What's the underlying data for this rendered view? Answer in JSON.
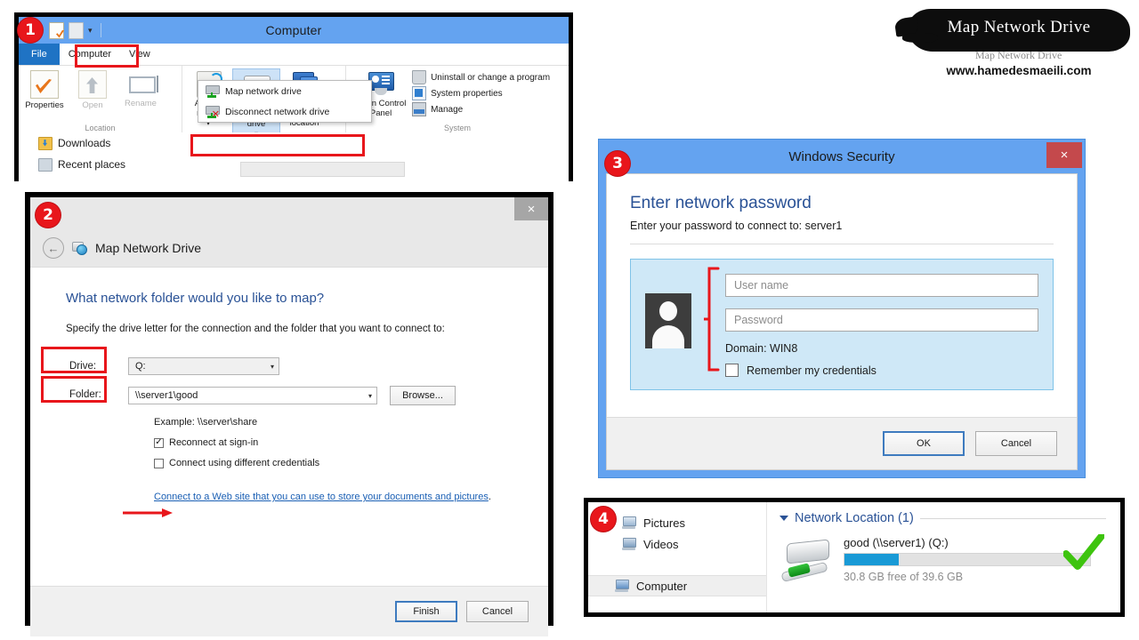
{
  "branding": {
    "title": "Map Network Drive",
    "ghost_text": "Map Network Drive",
    "url": "www.hamedesmaeili.com"
  },
  "panel1": {
    "step_badge": "1",
    "window_title": "Computer",
    "quick_access": [
      "properties-doc-icon",
      "folder-icon",
      "dropdown-arrow-icon"
    ],
    "tabs": [
      {
        "label": "File",
        "state": "file-menu"
      },
      {
        "label": "Computer",
        "state": "selected"
      },
      {
        "label": "View",
        "state": "normal"
      }
    ],
    "ribbon_groups": [
      {
        "group_label": "Location",
        "buttons": [
          {
            "label": "Properties",
            "icon": "properties-icon",
            "enabled": true
          },
          {
            "label": "Open",
            "icon": "open-icon",
            "enabled": false
          },
          {
            "label": "Rename",
            "icon": "rename-icon",
            "enabled": false
          }
        ]
      },
      {
        "group_label": "",
        "buttons": [
          {
            "label": "Access media",
            "icon": "access-media-icon",
            "enabled": true,
            "has_dropdown": true
          },
          {
            "label": "Map network drive",
            "icon": "map-network-drive-icon",
            "enabled": true,
            "has_dropdown": true,
            "active": true
          },
          {
            "label": "Add a network location",
            "icon": "add-network-location-icon",
            "enabled": true
          }
        ]
      },
      {
        "group_label": "System",
        "big_button": {
          "label": "Open Control Panel",
          "icon": "control-panel-icon"
        },
        "small_items": [
          {
            "label": "Uninstall or change a program",
            "icon": "uninstall-program-icon"
          },
          {
            "label": "System properties",
            "icon": "system-properties-icon"
          },
          {
            "label": "Manage",
            "icon": "manage-icon"
          }
        ]
      }
    ],
    "dropdown_menu": [
      {
        "label": "Map network drive",
        "icon": "map-drive-icon",
        "highlighted": true
      },
      {
        "label": "Disconnect network drive",
        "icon": "disconnect-drive-icon",
        "highlighted": false
      }
    ],
    "nav_items": [
      {
        "label": "Downloads",
        "icon": "downloads-folder-icon"
      },
      {
        "label": "Recent places",
        "icon": "recent-places-icon"
      }
    ]
  },
  "panel2": {
    "step_badge": "2",
    "close_label": "×",
    "back_label": "←",
    "header_title": "Map Network Drive",
    "question": "What network folder would you like to map?",
    "subtitle": "Specify the drive letter for the connection and the folder that you want to connect to:",
    "drive_label": "Drive:",
    "drive_value": "Q:",
    "folder_label": "Folder:",
    "folder_value": "\\\\server1\\good",
    "browse_label": "Browse...",
    "example": "Example: \\\\server\\share",
    "reconnect_label": "Reconnect at sign-in",
    "reconnect_checked": true,
    "credentials_label": "Connect using different credentials",
    "credentials_checked": false,
    "web_link": "Connect to a Web site that you can use to store your documents and pictures",
    "web_link_period": ".",
    "finish_label": "Finish",
    "cancel_label": "Cancel"
  },
  "panel3": {
    "step_badge": "3",
    "title": "Windows Security",
    "close_label": "×",
    "heading": "Enter network password",
    "subheading": "Enter your password to connect to: server1",
    "username_placeholder": "User name",
    "username_value": "",
    "password_placeholder": "Password",
    "password_value": "",
    "domain": "Domain: WIN8",
    "remember_label": "Remember my credentials",
    "remember_checked": false,
    "ok_label": "OK",
    "cancel_label": "Cancel"
  },
  "panel4": {
    "step_badge": "4",
    "sidebar": [
      {
        "label": "Pictures",
        "icon": "pictures-icon",
        "selected": false
      },
      {
        "label": "Videos",
        "icon": "videos-icon",
        "selected": false
      },
      {
        "label": "Computer",
        "icon": "computer-icon",
        "selected": true
      }
    ],
    "group_header": "Network Location (1)",
    "drive_name": "good (\\\\server1) (Q:)",
    "capacity_text": "30.8 GB free of 39.6 GB",
    "used_percent": 22,
    "status": "mapped-success"
  },
  "colors": {
    "window_blue": "#64a3f0",
    "annotation_red": "#e8161b",
    "link_blue": "#1a5fb4",
    "heading_blue": "#2a5296",
    "progress_blue": "#199ad6",
    "success_green": "#3ec40f",
    "close_red": "#c4494c"
  }
}
